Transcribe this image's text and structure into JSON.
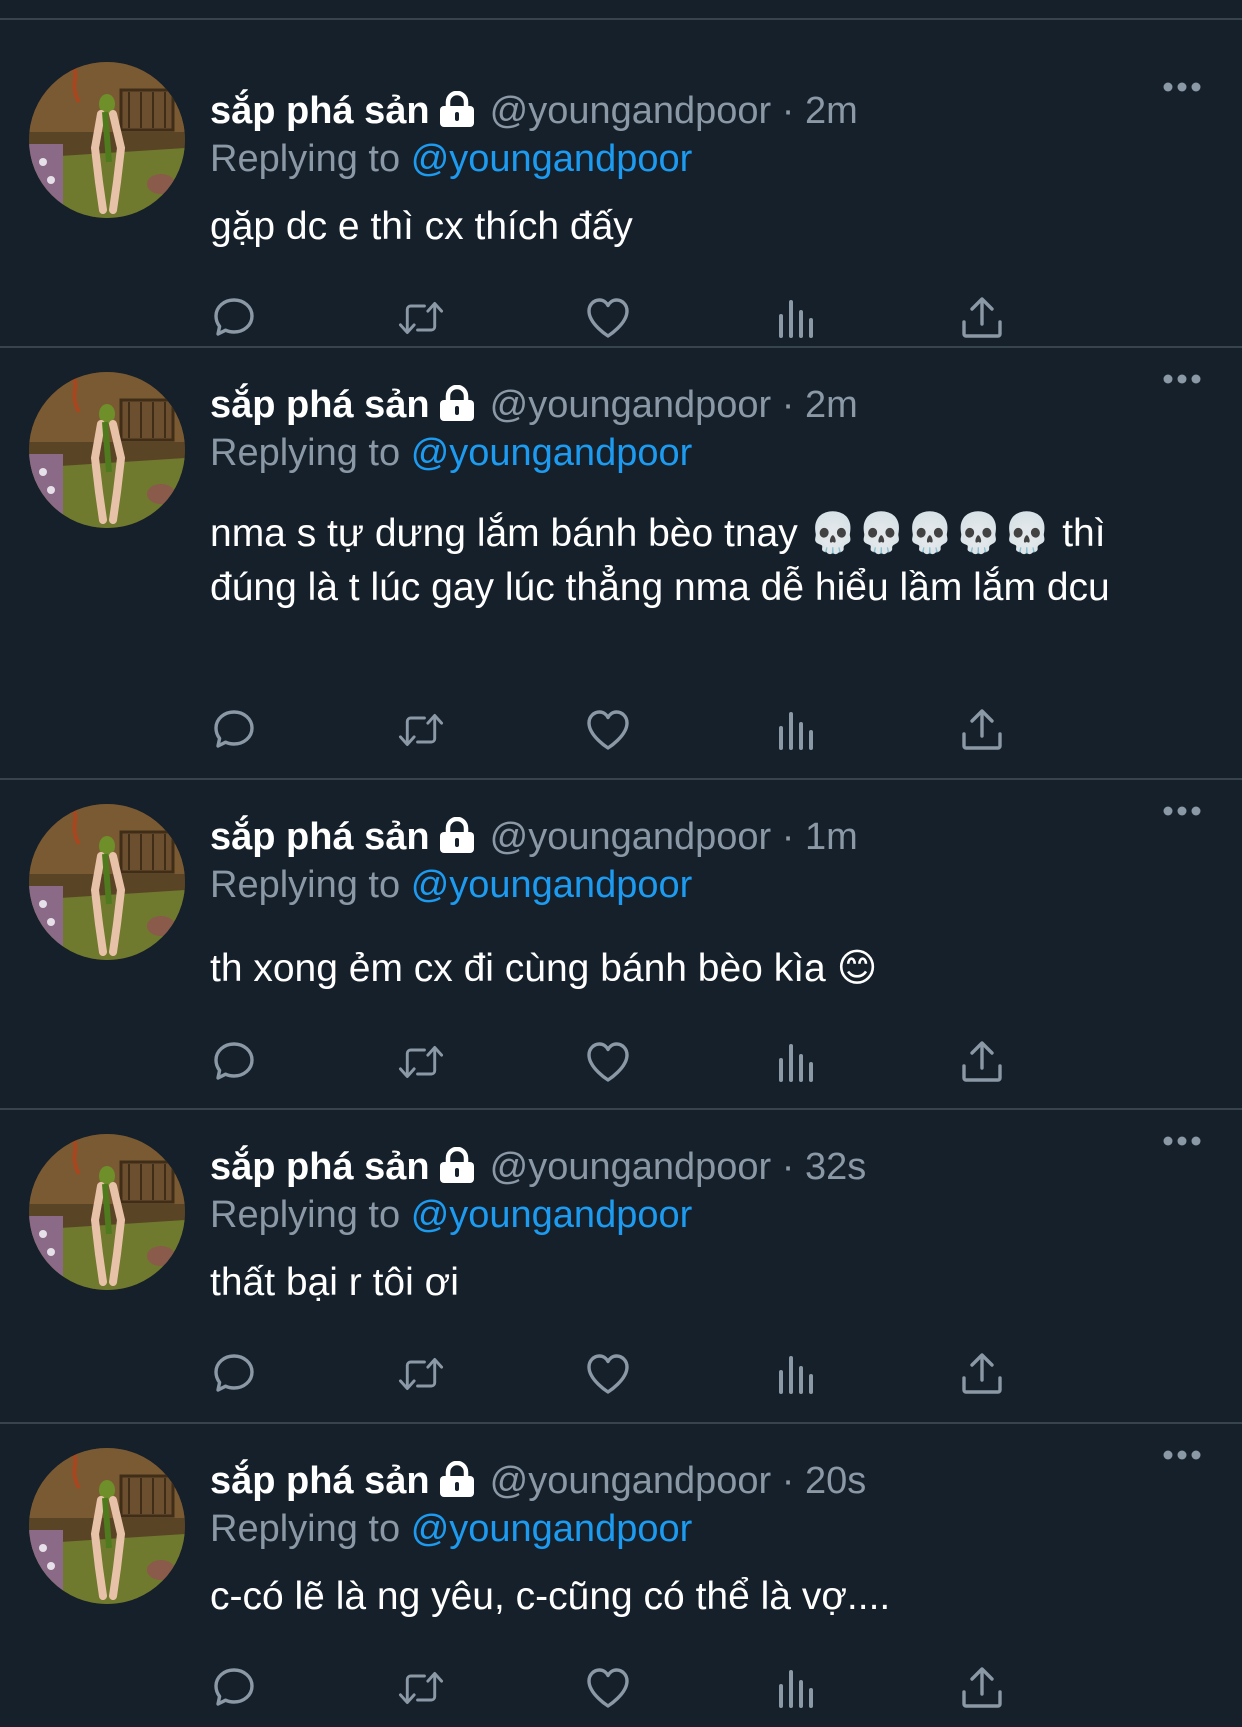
{
  "colors": {
    "background": "#15202b",
    "divider": "#38444d",
    "text_primary": "#ffffff",
    "text_secondary": "#8b98a5",
    "link": "#1d9bf0"
  },
  "tweets": [
    {
      "display_name": "sắp phá sản",
      "handle": "@youngandpoor",
      "separator": "·",
      "time": "2m",
      "replying_prefix": "Replying to",
      "replying_to": "@youngandpoor",
      "text": "gặp dc e thì cx thích đấy",
      "icons": [
        "lock-icon",
        "more-icon",
        "reply-icon",
        "retweet-icon",
        "like-icon",
        "views-icon",
        "share-icon"
      ]
    },
    {
      "display_name": "sắp phá sản",
      "handle": "@youngandpoor",
      "separator": "·",
      "time": "2m",
      "replying_prefix": "Replying to",
      "replying_to": "@youngandpoor",
      "text": "nma s tự dưng lắm bánh bèo tnay 💀💀💀💀💀 thì đúng là t lúc gay lúc thẳng nma dễ hiểu lầm lắm dcu",
      "icons": [
        "lock-icon",
        "more-icon",
        "reply-icon",
        "retweet-icon",
        "like-icon",
        "views-icon",
        "share-icon"
      ]
    },
    {
      "display_name": "sắp phá sản",
      "handle": "@youngandpoor",
      "separator": "·",
      "time": "1m",
      "replying_prefix": "Replying to",
      "replying_to": "@youngandpoor",
      "text": "th xong ẻm cx đi cùng bánh bèo kìa 😊",
      "icons": [
        "lock-icon",
        "more-icon",
        "reply-icon",
        "retweet-icon",
        "like-icon",
        "views-icon",
        "share-icon"
      ]
    },
    {
      "display_name": "sắp phá sản",
      "handle": "@youngandpoor",
      "separator": "·",
      "time": "32s",
      "replying_prefix": "Replying to",
      "replying_to": "@youngandpoor",
      "text": "thất bại r tôi ơi",
      "icons": [
        "lock-icon",
        "more-icon",
        "reply-icon",
        "retweet-icon",
        "like-icon",
        "views-icon",
        "share-icon"
      ]
    },
    {
      "display_name": "sắp phá sản",
      "handle": "@youngandpoor",
      "separator": "·",
      "time": "20s",
      "replying_prefix": "Replying to",
      "replying_to": "@youngandpoor",
      "text": "c-có lẽ là ng yêu, c-cũng có thể là vợ....",
      "icons": [
        "lock-icon",
        "more-icon",
        "reply-icon",
        "retweet-icon",
        "like-icon",
        "views-icon",
        "share-icon"
      ]
    }
  ]
}
